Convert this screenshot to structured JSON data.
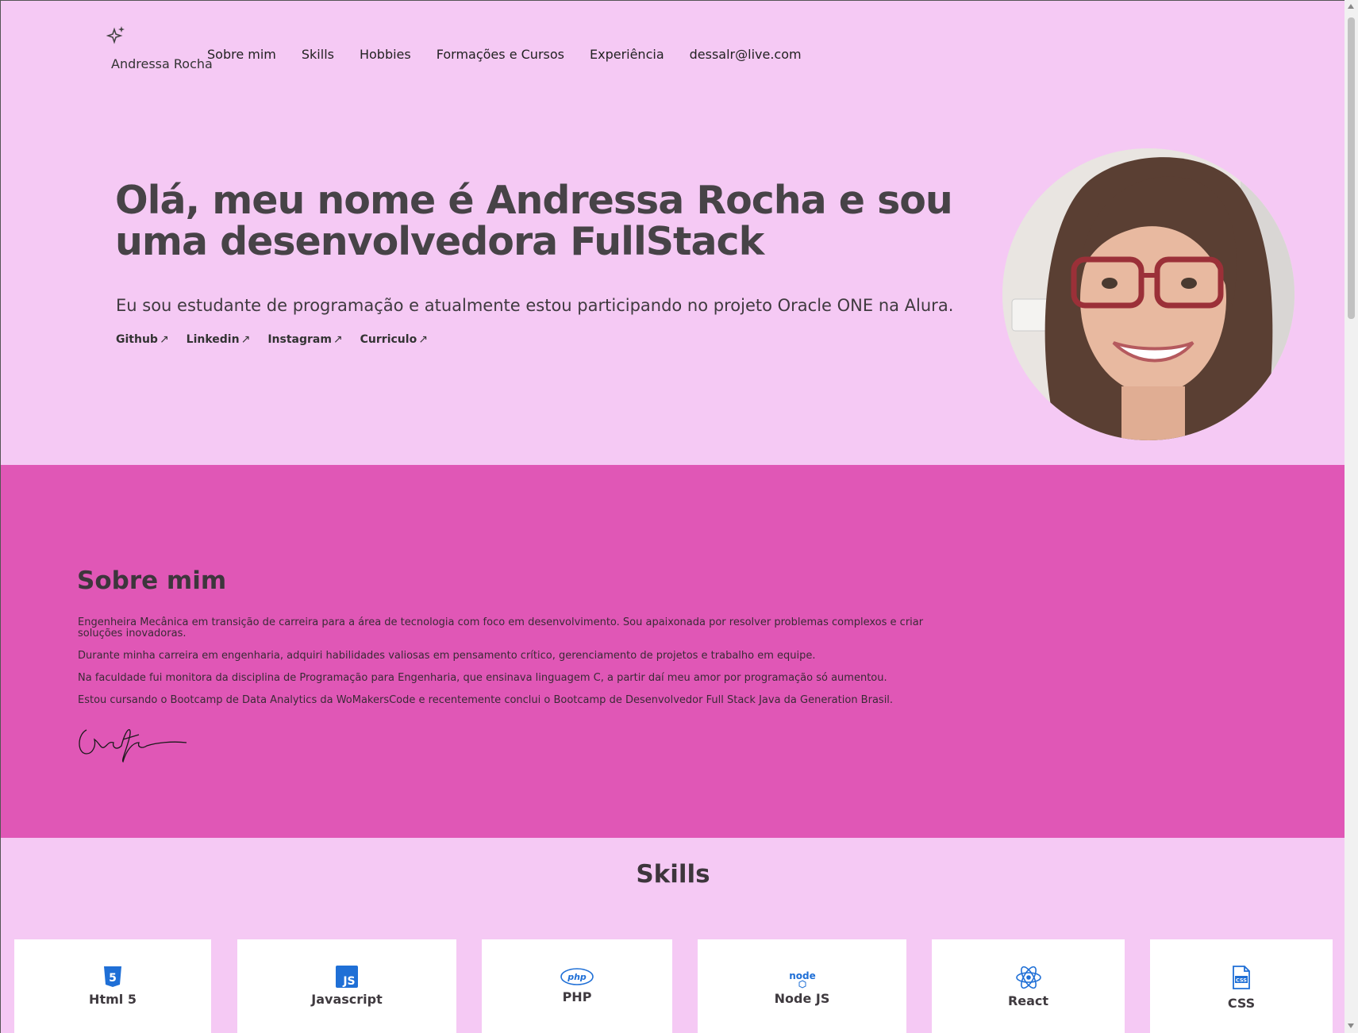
{
  "header": {
    "brand": "Andressa Rocha",
    "nav": [
      "Sobre mim",
      "Skills",
      "Hobbies",
      "Formações e Cursos",
      "Experiência",
      "dessalr@live.com"
    ]
  },
  "hero": {
    "title": "Olá, meu nome é Andressa Rocha e sou uma desenvolvedora FullStack",
    "subtitle": "Eu sou estudante de programação e atualmente estou participando no projeto Oracle ONE na Alura.",
    "links": [
      "Github",
      "Linkedin",
      "Instagram",
      "Curriculo"
    ],
    "link_arrow": "↗"
  },
  "about": {
    "title": "Sobre mim",
    "paragraphs": [
      "Engenheira Mecânica em transição de carreira para a área de tecnologia com foco em desenvolvimento. Sou apaixonada por resolver problemas complexos e criar soluções inovadoras.",
      "Durante minha carreira em engenharia, adquiri habilidades valiosas em pensamento crítico, gerenciamento de projetos e trabalho em equipe.",
      "Na faculdade fui monitora da disciplina de Programação para Engenharia, que ensinava linguagem C, a partir daí meu amor por programação só aumentou.",
      "Estou cursando o Bootcamp de Data Analytics da WoMakersCode e recentemente conclui o Bootcamp de Desenvolvedor Full Stack Java da Generation Brasil."
    ]
  },
  "skills": {
    "title": "Skills",
    "items": [
      {
        "label": "Html 5",
        "icon": "html5-icon"
      },
      {
        "label": "Javascript",
        "icon": "js-icon"
      },
      {
        "label": "PHP",
        "icon": "php-icon"
      },
      {
        "label": "Node JS",
        "icon": "nodejs-icon"
      },
      {
        "label": "React",
        "icon": "react-icon"
      },
      {
        "label": "CSS",
        "icon": "css-icon"
      }
    ]
  },
  "colors": {
    "page_bg": "#f5c9f4",
    "about_bg": "#e057b6",
    "icon_blue": "#1f6fd6"
  }
}
